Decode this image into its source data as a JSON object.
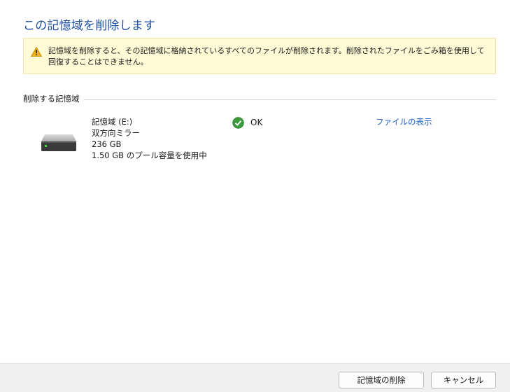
{
  "dialog": {
    "title": "この記憶域を削除します"
  },
  "warning": {
    "icon": "warning-icon",
    "text": "記憶域を削除すると、その記憶域に格納されているすべてのファイルが削除されます。削除されたファイルをごみ箱を使用して回復することはできません。"
  },
  "section": {
    "label": "削除する記憶域"
  },
  "drive": {
    "icon": "drive-icon",
    "name": "記憶域 (E:)",
    "resiliency": "双方向ミラー",
    "size": "236 GB",
    "pool_usage": "1.50 GB のプール容量を使用中",
    "status_icon": "check-circle-icon",
    "status": "OK",
    "status_color": "#3a9b3a",
    "view_files_label": "ファイルの表示"
  },
  "footer": {
    "delete_label": "記憶域の削除",
    "cancel_label": "キャンセル"
  }
}
